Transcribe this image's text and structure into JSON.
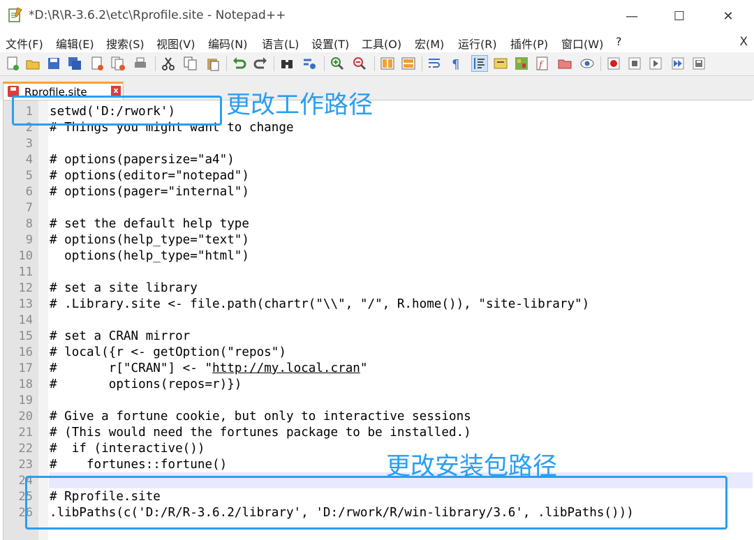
{
  "window": {
    "title": "*D:\\R\\R-3.6.2\\etc\\Rprofile.site - Notepad++",
    "minimize": "—",
    "maximize": "☐",
    "close": "✕"
  },
  "menu": [
    "文件(F)",
    "编辑(E)",
    "搜索(S)",
    "视图(V)",
    "编码(N)",
    "语言(L)",
    "设置(T)",
    "工具(O)",
    "宏(M)",
    "运行(R)",
    "插件(P)",
    "窗口(W)",
    "?"
  ],
  "menu_close": "X",
  "tab": {
    "label": "Rprofile.site",
    "close": "x"
  },
  "lines": [
    {
      "n": "1",
      "text": "setwd('D:/rwork')"
    },
    {
      "n": "2",
      "text": "# Things you might want to change"
    },
    {
      "n": "3",
      "text": ""
    },
    {
      "n": "4",
      "text": "# options(papersize=\"a4\")"
    },
    {
      "n": "5",
      "text": "# options(editor=\"notepad\")"
    },
    {
      "n": "6",
      "text": "# options(pager=\"internal\")"
    },
    {
      "n": "7",
      "text": ""
    },
    {
      "n": "8",
      "text": "# set the default help type"
    },
    {
      "n": "9",
      "text": "# options(help_type=\"text\")"
    },
    {
      "n": "10",
      "text": "  options(help_type=\"html\")"
    },
    {
      "n": "11",
      "text": ""
    },
    {
      "n": "12",
      "text": "# set a site library"
    },
    {
      "n": "13",
      "text": "# .Library.site <- file.path(chartr(\"\\\\\", \"/\", R.home()), \"site-library\")"
    },
    {
      "n": "14",
      "text": ""
    },
    {
      "n": "15",
      "text": "# set a CRAN mirror"
    },
    {
      "n": "16",
      "text": "# local({r <- getOption(\"repos\")"
    },
    {
      "n": "17",
      "text": "#       r[\"CRAN\"] <- \"",
      "link": "http://my.local.cran",
      "after": "\""
    },
    {
      "n": "18",
      "text": "#       options(repos=r)})"
    },
    {
      "n": "19",
      "text": ""
    },
    {
      "n": "20",
      "text": "# Give a fortune cookie, but only to interactive sessions"
    },
    {
      "n": "21",
      "text": "# (This would need the fortunes package to be installed.)"
    },
    {
      "n": "22",
      "text": "#  if (interactive())"
    },
    {
      "n": "23",
      "text": "#    fortunes::fortune()"
    },
    {
      "n": "24",
      "text": ""
    },
    {
      "n": "25",
      "text": "# Rprofile.site"
    },
    {
      "n": "26",
      "text": ".libPaths(c('D:/R/R-3.6.2/library', 'D:/rwork/R/win-library/3.6', .libPaths()))"
    }
  ],
  "annotations": {
    "workdir": "更改工作路径",
    "libpath": "更改安装包路径"
  },
  "colors": {
    "annotation": "#2a9ef0",
    "tab_accent": "#f7a233",
    "current_line": "#e8e8ff"
  }
}
